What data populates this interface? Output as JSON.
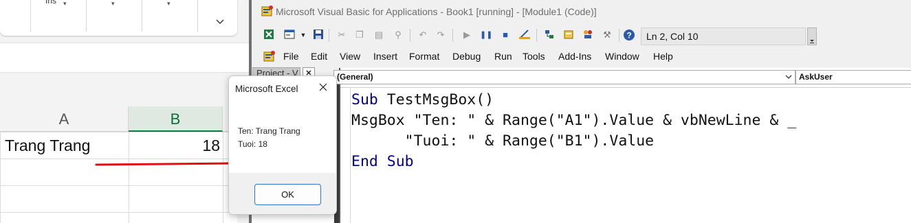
{
  "excel": {
    "ribbon_ins_label": "Ins",
    "columns": [
      "A",
      "B"
    ],
    "cells": {
      "a1": "Trang Trang",
      "b1": "18"
    }
  },
  "msgbox": {
    "title": "Microsoft Excel",
    "lines": [
      "Ten: Trang Trang",
      "Tuoi: 18"
    ],
    "ok_label": "OK"
  },
  "vba": {
    "title": "Microsoft Visual Basic for Applications - Book1 [running] - [Module1 (Code)]",
    "position": "Ln 2, Col 10",
    "menu": [
      "File",
      "Edit",
      "View",
      "Insert",
      "Format",
      "Debug",
      "Run",
      "Tools",
      "Add-Ins",
      "Window",
      "Help"
    ],
    "project_label": "Project - V",
    "object_combo": "(General)",
    "procedure_combo": "AskUser",
    "code": {
      "line1_kw": "Sub",
      "line1_rest": " TestMsgBox()",
      "line2": "MsgBox \"Ten: \" & Range(\"A1\").Value & vbNewLine & _",
      "line3": "      \"Tuoi: \" & Range(\"B1\").Value",
      "line4_kw": "End Sub"
    }
  },
  "colors": {
    "keyword": "#00008b",
    "arrow": "#e01010",
    "selected_column": "#107c41"
  }
}
